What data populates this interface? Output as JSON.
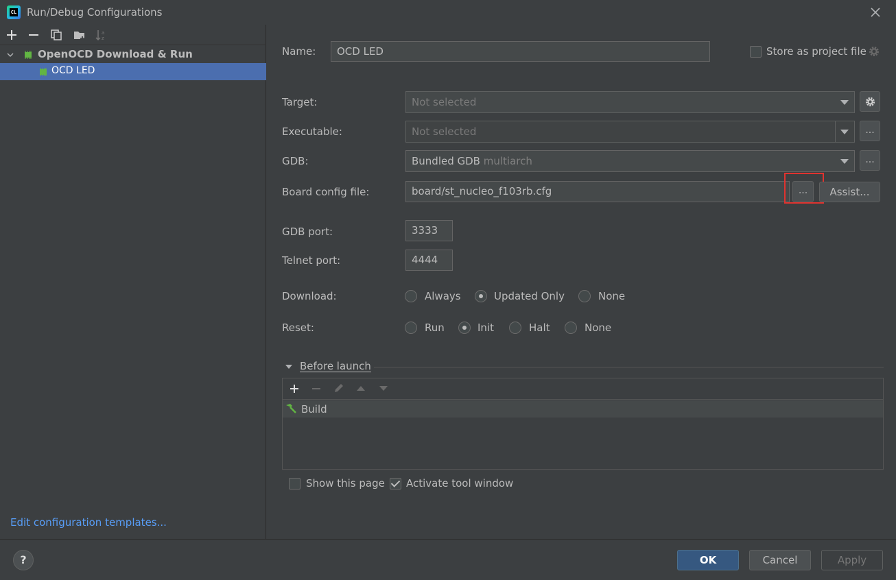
{
  "window": {
    "title": "Run/Debug Configurations",
    "app_icon_text": "CL"
  },
  "tree": {
    "group_label": "OpenOCD Download & Run",
    "selected_item": "OCD LED"
  },
  "left_footer": {
    "templates_link": "Edit configuration templates..."
  },
  "form": {
    "name_label": "Name:",
    "name_value": "OCD LED",
    "store_label": "Store as project file",
    "target_label": "Target:",
    "target_value": "Not selected",
    "executable_label": "Executable:",
    "executable_value": "Not selected",
    "gdb_label": "GDB:",
    "gdb_value_main": "Bundled GDB",
    "gdb_value_extra": "multiarch",
    "board_label": "Board config file:",
    "board_value": "board/st_nucleo_f103rb.cfg",
    "browse_label": "...",
    "assist_label": "Assist...",
    "gdb_port_label": "GDB port:",
    "gdb_port_value": "3333",
    "telnet_port_label": "Telnet port:",
    "telnet_port_value": "4444",
    "download_label": "Download:",
    "download_options": [
      "Always",
      "Updated Only",
      "None"
    ],
    "download_selected": "Updated Only",
    "reset_label": "Reset:",
    "reset_options": [
      "Run",
      "Init",
      "Halt",
      "None"
    ],
    "reset_selected": "Init"
  },
  "before_launch": {
    "title": "Before launch",
    "items": [
      "Build"
    ],
    "show_page_label": "Show this page",
    "show_page_checked": false,
    "activate_label": "Activate tool window",
    "activate_checked": true
  },
  "buttons": {
    "help": "?",
    "ok": "OK",
    "cancel": "Cancel",
    "apply": "Apply"
  },
  "colors": {
    "background": "#3c3f41",
    "selection": "#4b6eaf",
    "link": "#589df6",
    "highlight": "#e0332f",
    "primary": "#365880"
  }
}
